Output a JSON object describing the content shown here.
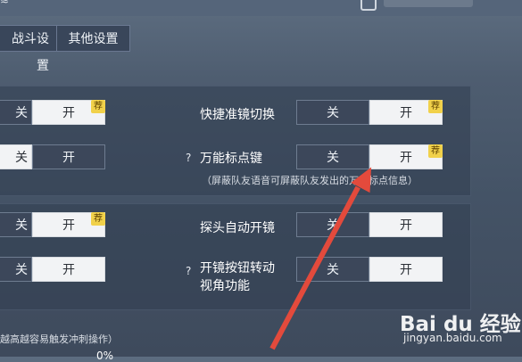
{
  "header": {
    "top_text": "≈"
  },
  "tabs": [
    {
      "label": "战斗设置"
    },
    {
      "label": "其他设置"
    }
  ],
  "panel1": {
    "rows": [
      {
        "left": {
          "off_label": "关",
          "on_label": "开",
          "badge": "荐"
        },
        "right": {
          "label": "快捷准镜切换",
          "off_label": "关",
          "on_label": "开",
          "badge": "荐"
        }
      },
      {
        "left": {
          "off_label": "关",
          "on_label": "开"
        },
        "right": {
          "label": "万能标点键",
          "qmark": "?",
          "off_label": "关",
          "on_label": "开",
          "badge": "荐",
          "hint": "（屏蔽队友语音可屏蔽队友发出的万能标点信息）"
        }
      }
    ]
  },
  "panel2": {
    "rows": [
      {
        "left": {
          "off_label": "关",
          "on_label": "开",
          "badge": "荐"
        },
        "right": {
          "label": "探头自动开镜",
          "off_label": "关",
          "on_label": "开"
        }
      },
      {
        "left": {
          "off_label": "关",
          "on_label": "开"
        },
        "right": {
          "label_line1": "开镜按钮转动",
          "label_line2": "视角功能",
          "qmark": "?",
          "off_label": "关",
          "on_label": "开"
        }
      }
    ]
  },
  "bottom": {
    "text": "越高越容易触发冲刺操作）",
    "percent": "0%"
  },
  "watermark": {
    "logo": "Bai du 经验",
    "url": "jingyan.baidu.com"
  },
  "colors": {
    "accent_badge": "#f1d14a",
    "arrow": "#e34a3c",
    "toggle_on": "#f2f3f5",
    "toggle_off": "#3c475a"
  }
}
